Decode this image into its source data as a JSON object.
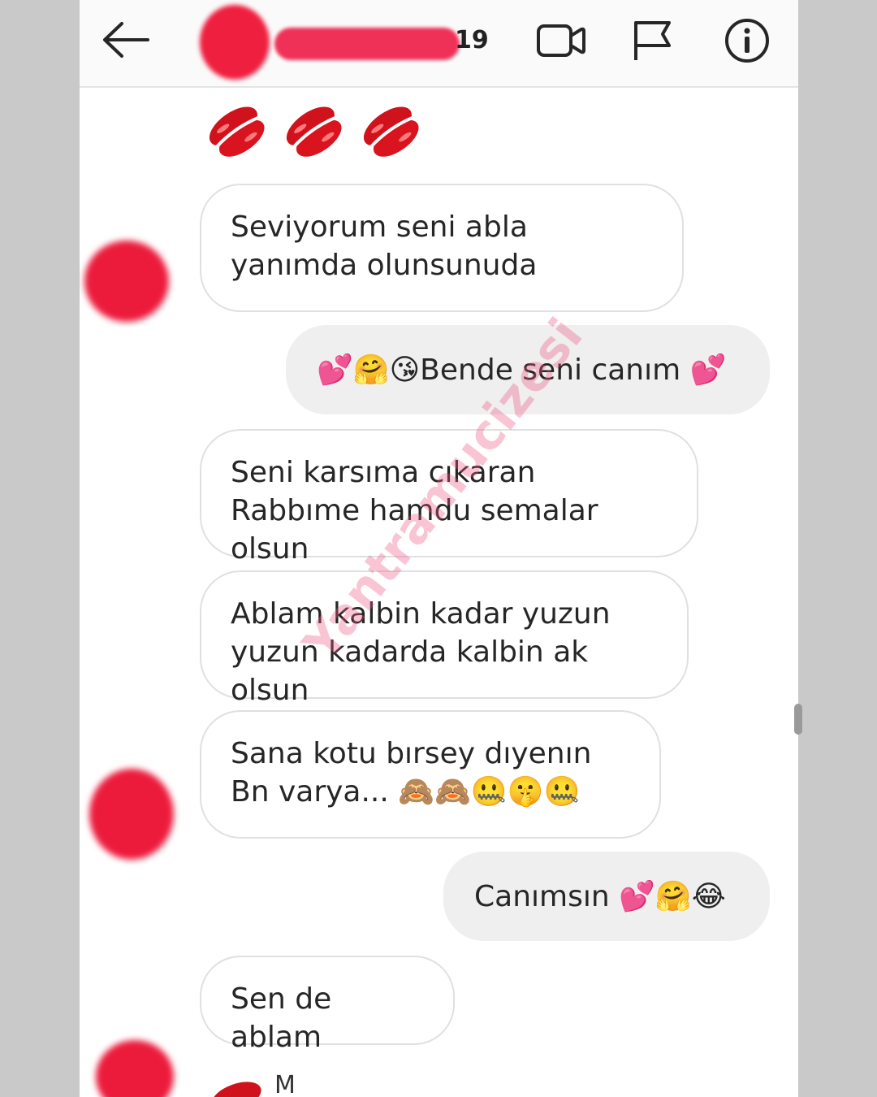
{
  "header": {
    "name_suffix": "19",
    "back": "back-icon",
    "video_call": "video-call-icon",
    "report": "flag-icon",
    "info": "info-icon"
  },
  "messages": [
    {
      "side": "in",
      "text": "Seviyorum seni abla yanımda olunsunuda"
    },
    {
      "side": "out",
      "text": "💕🤗😘Bende seni canım 💕"
    },
    {
      "side": "in",
      "text": "Seni karsıma cıkaran Rabbıme hamdu semalar olsun"
    },
    {
      "side": "in",
      "text": "Ablam kalbin kadar yuzun yuzun kadarda kalbin ak olsun"
    },
    {
      "side": "in",
      "text": "Sana kotu bırsey dıyenın Bn varya... 🙈🙈🤐🤫🤐"
    },
    {
      "side": "out",
      "text": "Canımsın 💕🤗😂"
    },
    {
      "side": "in",
      "text": "Sen de ablam"
    }
  ],
  "partial_message": "M",
  "watermark": "Yantramucizesi",
  "colors": {
    "incoming_bubble": "#ffffff",
    "outgoing_bubble": "#efefef",
    "redaction": "#ef1f3f",
    "watermark": "#ee5884"
  }
}
